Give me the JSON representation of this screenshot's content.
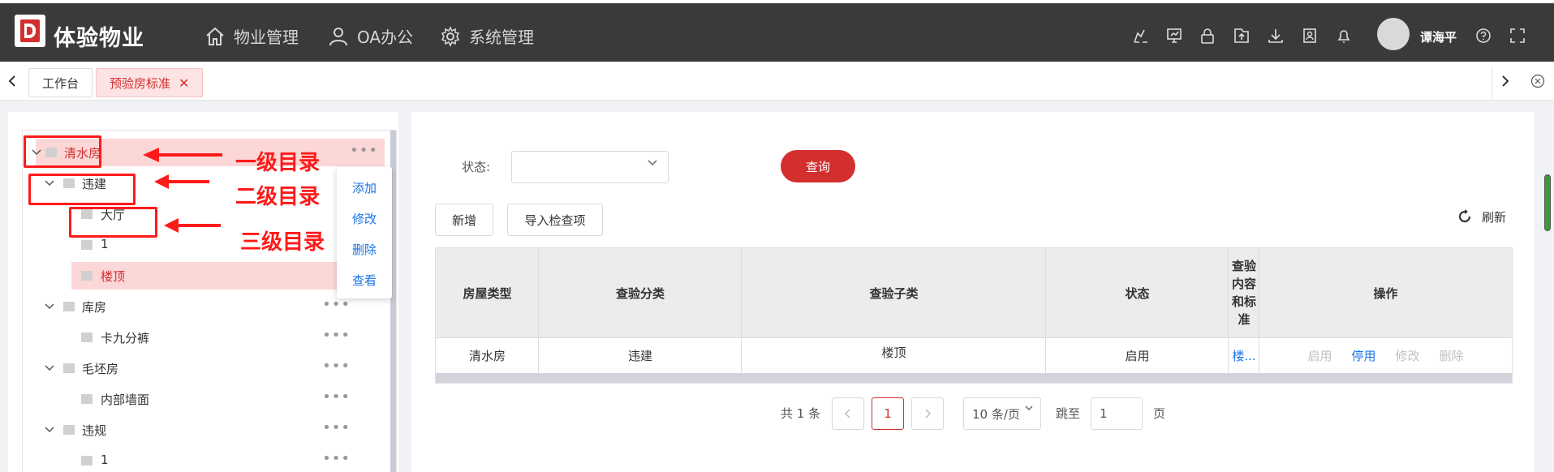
{
  "header": {
    "app_title": "体验物业",
    "nav": [
      {
        "label": "物业管理",
        "icon": "home-icon"
      },
      {
        "label": "OA办公",
        "icon": "user-icon"
      },
      {
        "label": "系统管理",
        "icon": "gear-icon"
      }
    ],
    "username": "谭海平"
  },
  "tabs": [
    {
      "label": "工作台"
    },
    {
      "label": "预验房标准",
      "active": true
    }
  ],
  "tree": {
    "nodes": [
      {
        "label": "清水房",
        "level": 1
      },
      {
        "label": "违建",
        "level": 2
      },
      {
        "label": "大厅",
        "level": 3
      },
      {
        "label": "1",
        "level": 3
      },
      {
        "label": "楼顶",
        "level": 3
      },
      {
        "label": "库房",
        "level": 2
      },
      {
        "label": "卡九分裤",
        "level": 3
      },
      {
        "label": "毛坯房",
        "level": 2
      },
      {
        "label": "内部墙面",
        "level": 3
      },
      {
        "label": "违规",
        "level": 2
      },
      {
        "label": "1",
        "level": 3
      }
    ],
    "menu": [
      "添加",
      "修改",
      "删除",
      "查看"
    ]
  },
  "annotations": {
    "level1": "一级目录",
    "level2": "二级目录",
    "level3": "三级目录"
  },
  "filter": {
    "status_label": "状态:",
    "query_button": "查询"
  },
  "toolbar": {
    "add_button": "新增",
    "import_button": "导入检查项",
    "refresh_label": "刷新"
  },
  "table": {
    "headers": [
      "房屋类型",
      "查验分类",
      "查验子类",
      "状态",
      "查验内容和标准",
      "操作"
    ],
    "rows": [
      {
        "house_type": "清水房",
        "category": "违建",
        "subcategory": "楼顶",
        "status": "启用",
        "content": "楼...",
        "ops": [
          "启用",
          "停用",
          "修改",
          "删除"
        ]
      }
    ]
  },
  "pagination": {
    "total": "共 1 条",
    "current_page": "1",
    "page_size": "10 条/页",
    "jump_label": "跳至",
    "jump_value": "1",
    "page_suffix": "页"
  },
  "colors": {
    "brand": "#d32f2f",
    "topbar": "#3a3a3a",
    "link": "#1a73e8",
    "annotation": "#ff1a1a"
  }
}
